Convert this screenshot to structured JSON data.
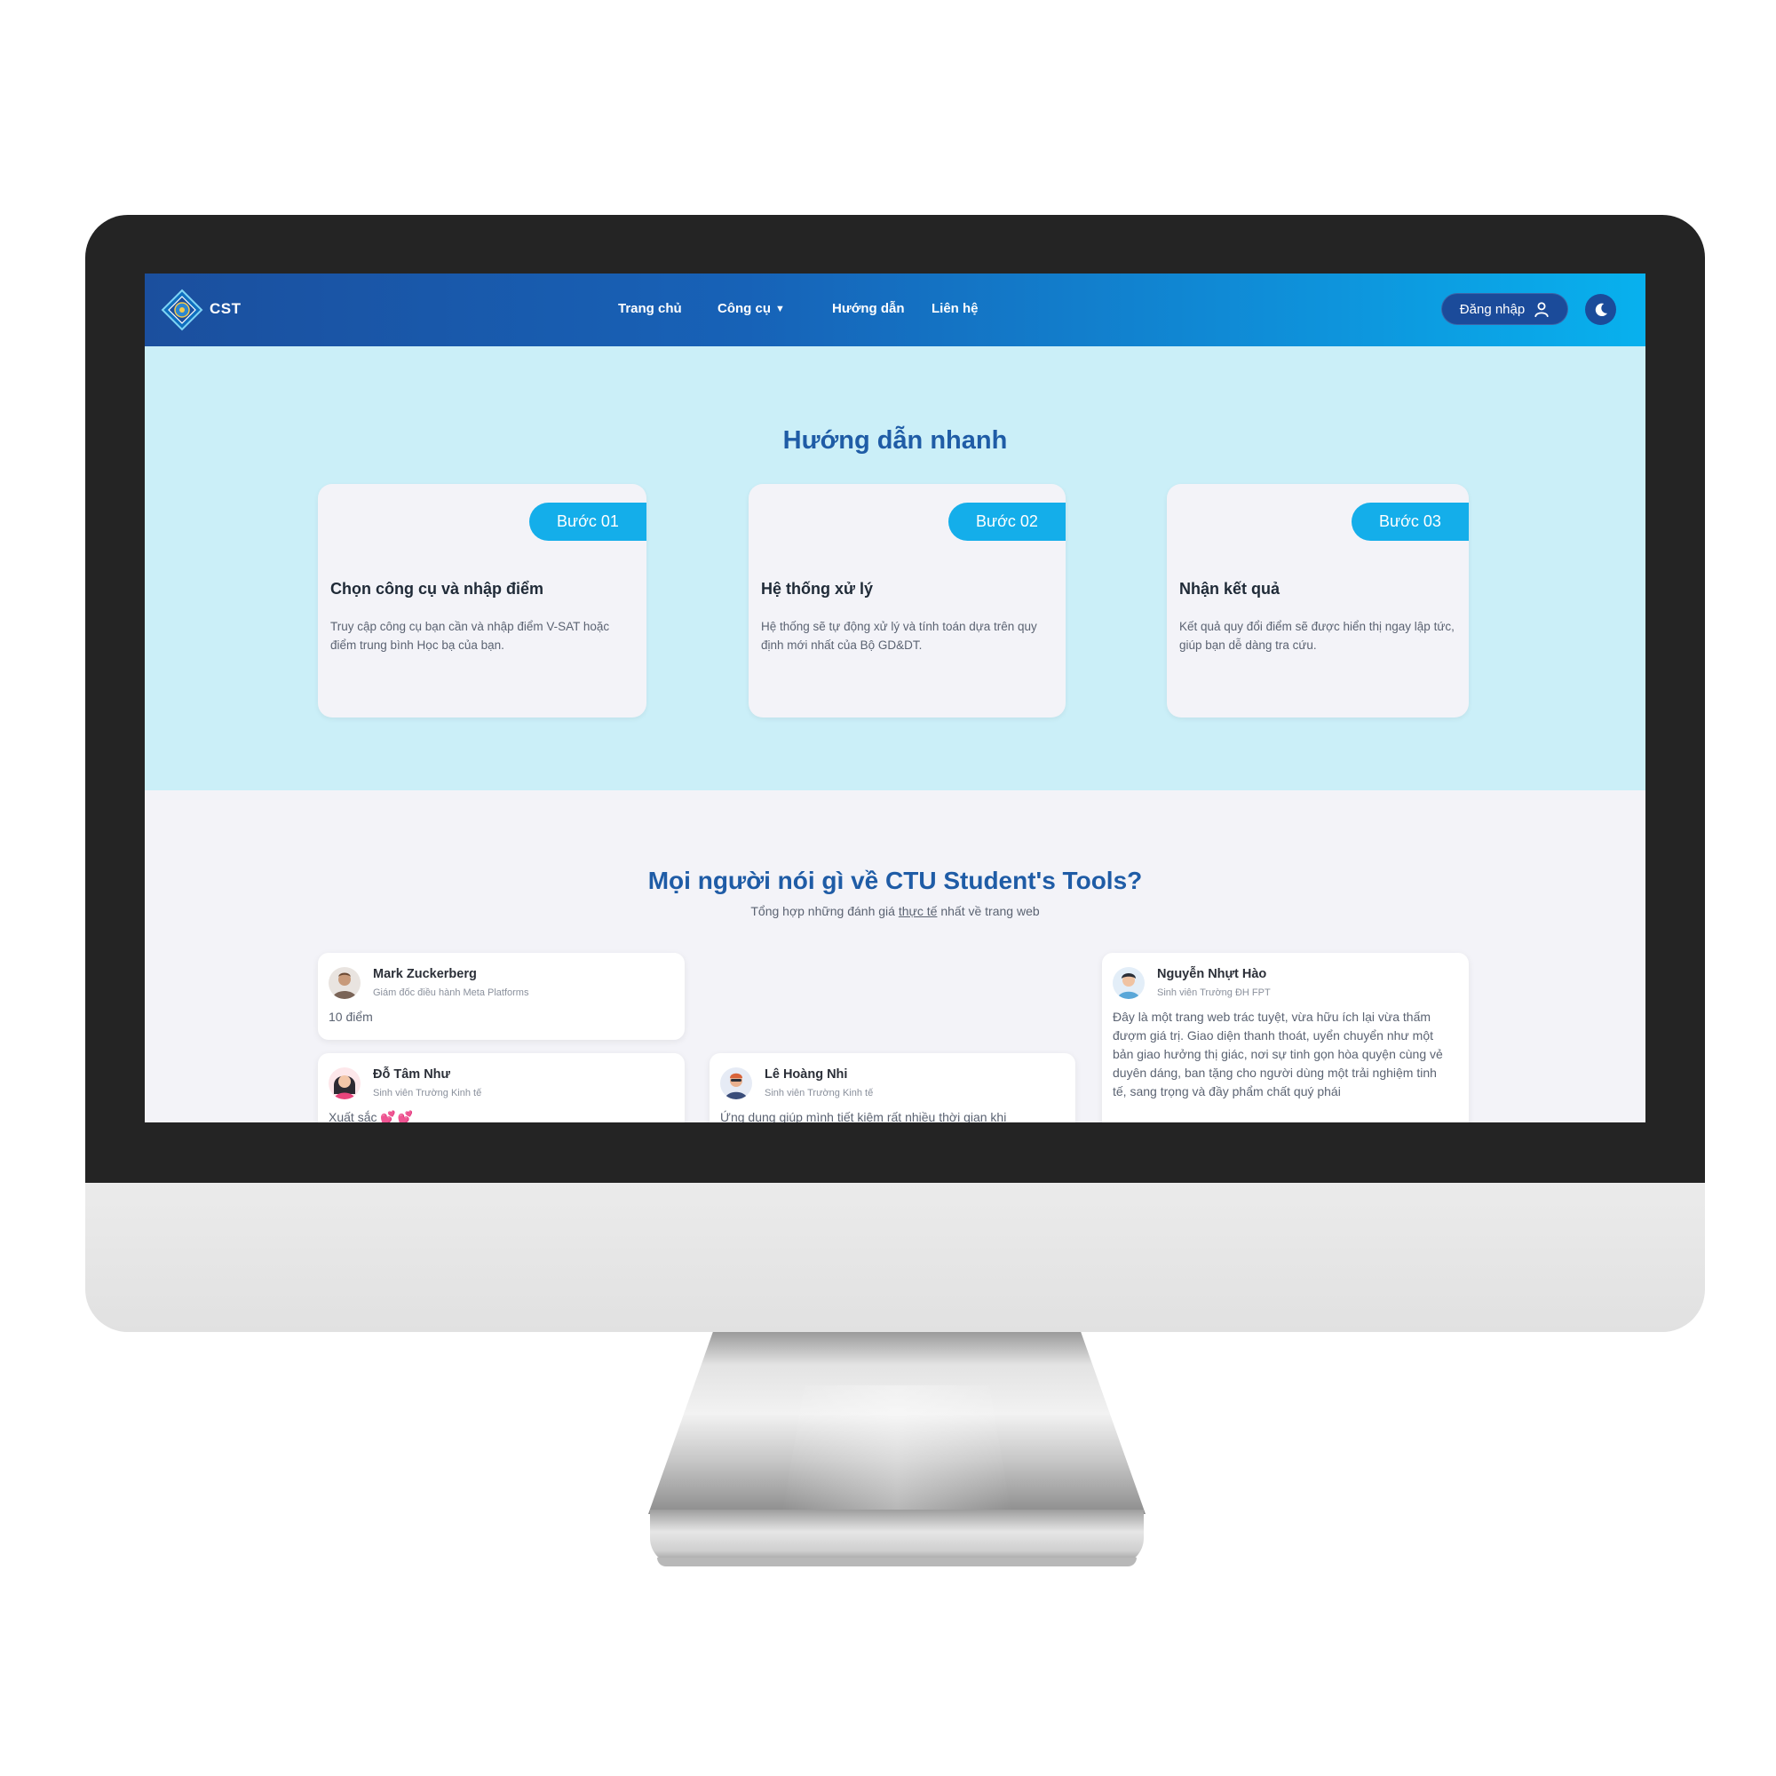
{
  "navbar": {
    "brand": "CST",
    "links": [
      "Trang chủ",
      "Công cụ",
      "Hướng dẫn",
      "Liên hệ"
    ],
    "login_label": "Đăng nhập",
    "colors": {
      "start": "#1b4f9e",
      "end": "#08b1ee"
    }
  },
  "guide": {
    "title": "Hướng dẫn nhanh",
    "steps": [
      {
        "badge": "Bước 01",
        "title": "Chọn công cụ và nhập điểm",
        "desc": "Truy cập công cụ bạn cần và nhập điểm V-SAT hoặc điểm trung bình Học bạ của bạn."
      },
      {
        "badge": "Bước 02",
        "title": "Hệ thống xử lý",
        "desc": "Hệ thống sẽ tự động xử lý và tính toán dựa trên quy định mới nhất của Bộ GD&DT."
      },
      {
        "badge": "Bước 03",
        "title": "Nhận kết quả",
        "desc": "Kết quả quy đổi điểm sẽ được hiển thị ngay lập tức, giúp bạn dễ dàng tra cứu."
      }
    ]
  },
  "reviews": {
    "title": "Mọi người nói gì về CTU Student's Tools?",
    "subtitle_pre": "Tổng hợp những đánh giá ",
    "subtitle_em": "thực tế",
    "subtitle_post": " nhất về trang web",
    "items": [
      {
        "name": "Mark Zuckerberg",
        "role": "Giám đốc điều hành Meta Platforms",
        "text": "10 điểm"
      },
      {
        "name": "Đỗ Tâm Như",
        "role": "Sinh viên Trường Kinh tế",
        "text": "Xuất sắc",
        "hearts": "💕💕"
      },
      {
        "name": "Lê Hoàng Nhi",
        "role": "Sinh viên Trường Kinh tế",
        "text": "Ứng dụng giúp mình tiết kiệm rất nhiều thời gian khi"
      },
      {
        "name": "Nguyễn Nhựt Hào",
        "role": "Sinh viên Trường ĐH FPT",
        "text": "Đây là một trang web trác tuyệt, vừa hữu ích lại vừa thấm đượm giá trị. Giao diện thanh thoát, uyển chuyển như một bản giao hưởng thị giác, nơi sự tinh gọn hòa quyện cùng vẻ duyên dáng, ban tặng cho người dùng một trải nghiệm tinh tế, sang trọng và đầy phẩm chất quý phái"
      }
    ]
  },
  "colors": {
    "accent": "#14aeea",
    "heading": "#1f5ca6",
    "guide_bg": "#cbeff8",
    "page_bg": "#f3f3f8",
    "bezel": "#242424"
  }
}
